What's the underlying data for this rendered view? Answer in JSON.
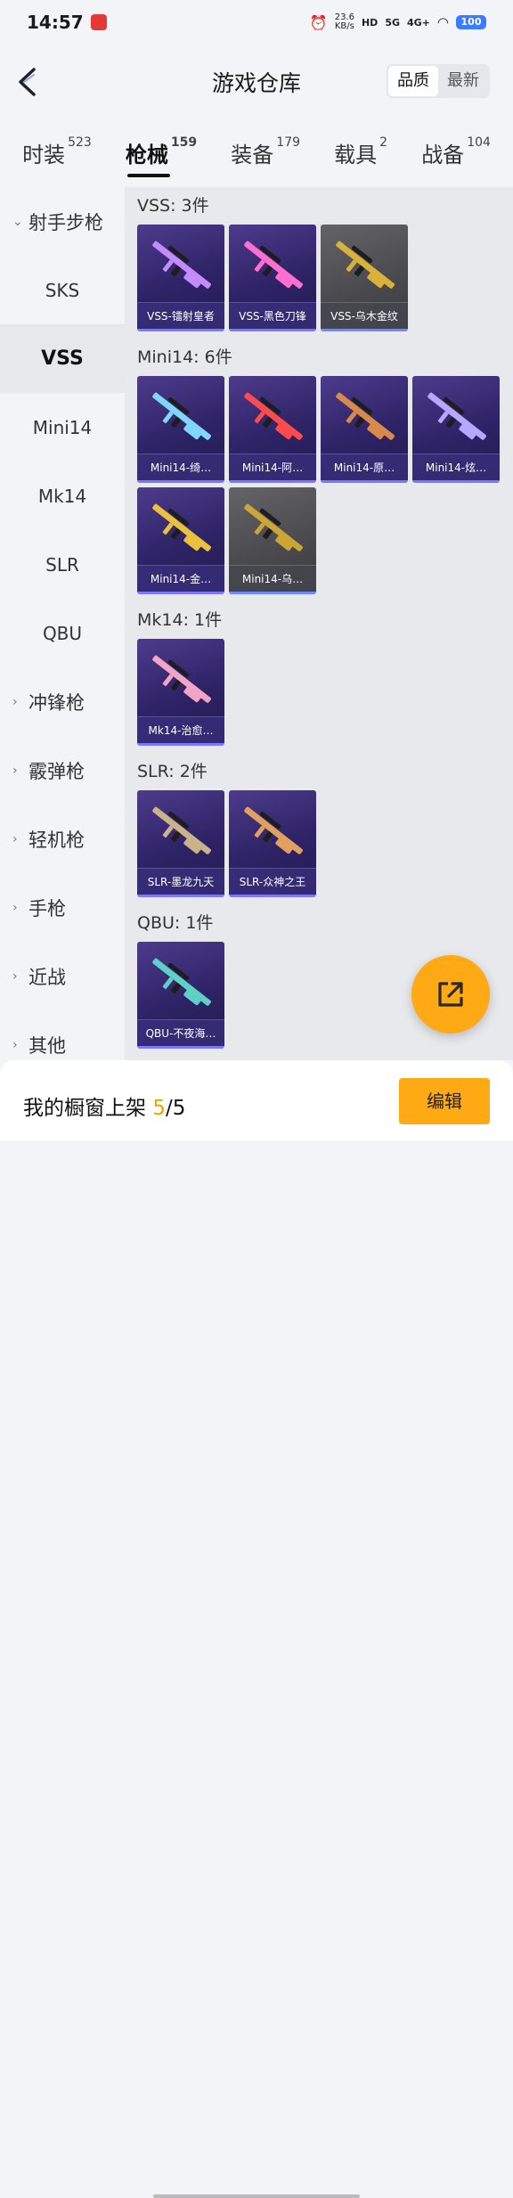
{
  "status": {
    "time": "14:57",
    "net_speed": "23.6",
    "net_unit": "KB/s",
    "signal1": "5G",
    "signal2": "4G+",
    "battery": "100"
  },
  "header": {
    "title": "游戏仓库",
    "sort_quality": "品质",
    "sort_newest": "最新"
  },
  "cattabs": [
    {
      "label": "时装",
      "count": "523"
    },
    {
      "label": "枪械",
      "count": "159"
    },
    {
      "label": "装备",
      "count": "179"
    },
    {
      "label": "载具",
      "count": "2"
    },
    {
      "label": "战备",
      "count": "104"
    }
  ],
  "sidebar": [
    {
      "label": "射手步枪",
      "type": "group",
      "chev": "⌄"
    },
    {
      "label": "SKS"
    },
    {
      "label": "VSS"
    },
    {
      "label": "Mini14"
    },
    {
      "label": "Mk14"
    },
    {
      "label": "SLR"
    },
    {
      "label": "QBU"
    },
    {
      "label": "冲锋枪",
      "type": "group",
      "chev": "›"
    },
    {
      "label": "霰弹枪",
      "type": "group",
      "chev": "›"
    },
    {
      "label": "轻机枪",
      "type": "group",
      "chev": "›"
    },
    {
      "label": "手枪",
      "type": "group",
      "chev": "›"
    },
    {
      "label": "近战",
      "type": "group",
      "chev": "›"
    },
    {
      "label": "其他",
      "type": "group",
      "chev": "›"
    }
  ],
  "sections": [
    {
      "title": "VSS: 3件",
      "items": [
        {
          "name": "VSS-镭射皇者",
          "gun": "#c28cff"
        },
        {
          "name": "VSS-黑色刀锋",
          "gun": "#ff6fd0"
        },
        {
          "name": "VSS-乌木金纹",
          "gun": "#d9b23a",
          "gray": true
        }
      ]
    },
    {
      "title": "Mini14: 6件",
      "items": [
        {
          "name": "Mini14-绮…",
          "gun": "#7fd7ff"
        },
        {
          "name": "Mini14-阿…",
          "gun": "#ff4b4b"
        },
        {
          "name": "Mini14-原…",
          "gun": "#d88a4a"
        },
        {
          "name": "Mini14-炫…",
          "gun": "#b6a7ff"
        },
        {
          "name": "Mini14-金…",
          "gun": "#e8c23a"
        },
        {
          "name": "Mini14-乌…",
          "gun": "#c9a635",
          "gray": true
        }
      ]
    },
    {
      "title": "Mk14: 1件",
      "items": [
        {
          "name": "Mk14-治愈…",
          "gun": "#f2a3c8"
        }
      ]
    },
    {
      "title": "SLR: 2件",
      "items": [
        {
          "name": "SLR-墨龙九天",
          "gun": "#c9b38a"
        },
        {
          "name": "SLR-众神之王",
          "gun": "#e0a060"
        }
      ]
    },
    {
      "title": "QBU: 1件",
      "items": [
        {
          "name": "QBU-不夜海…",
          "gun": "#5fd0c8"
        }
      ]
    }
  ],
  "bottom": {
    "label": "我的橱窗上架 ",
    "current": "5",
    "sep": "/",
    "total": "5",
    "edit": "编辑"
  },
  "colors": {
    "accent": "#ffa914",
    "card_purple": "#2e2366",
    "card_gray": "#4a4a4e"
  }
}
